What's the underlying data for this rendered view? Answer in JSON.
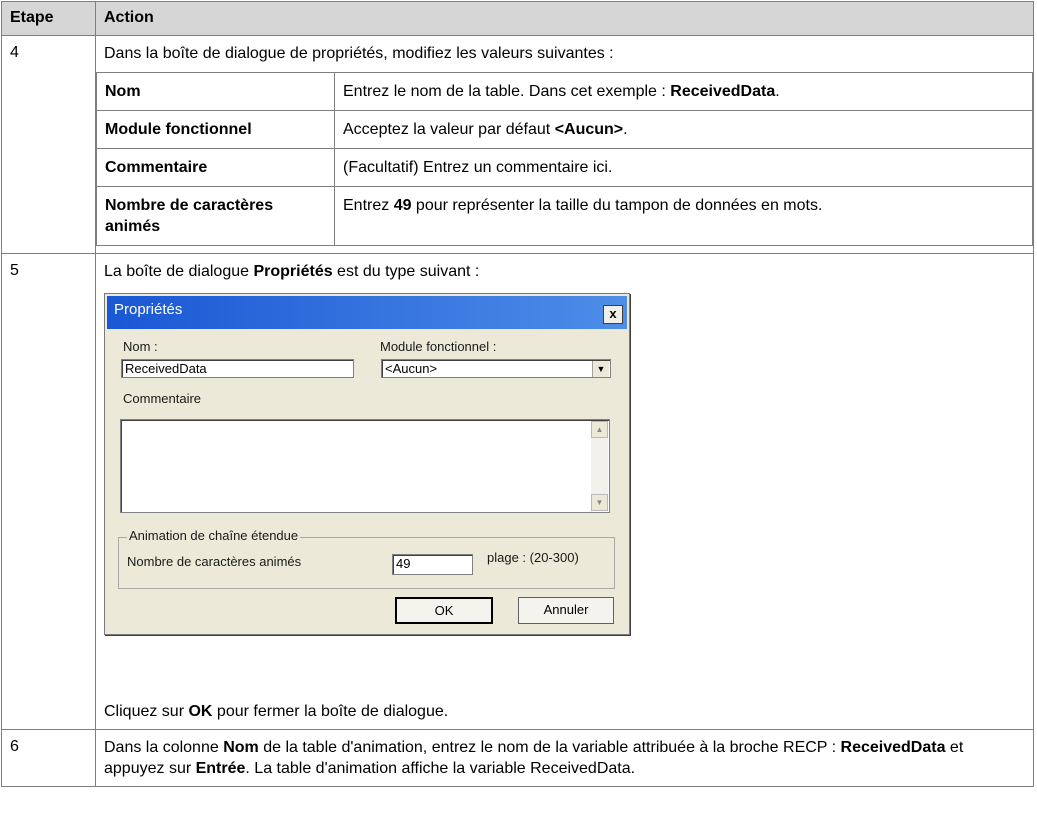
{
  "table": {
    "headers": {
      "step": "Etape",
      "action": "Action"
    }
  },
  "step4": {
    "number": "4",
    "intro": "Dans la boîte de dialogue de propriétés, modifiez les valeurs suivantes :",
    "rows": [
      {
        "key": "Nom",
        "pre": "Entrez le nom de la table. Dans cet exemple : ",
        "bold": "ReceivedData",
        "post": "."
      },
      {
        "key": "Module fonctionnel",
        "pre": "Acceptez la valeur par défaut ",
        "bold": "<Aucun>",
        "post": "."
      },
      {
        "key": "Commentaire",
        "pre": "(Facultatif) Entrez un commentaire ici.",
        "bold": "",
        "post": ""
      },
      {
        "key": "Nombre de caractères animés",
        "pre": "Entrez ",
        "bold": "49",
        "post": " pour représenter la taille du tampon de données en mots."
      }
    ]
  },
  "step5": {
    "number": "5",
    "intro_pre": "La boîte de dialogue ",
    "intro_bold": "Propriétés",
    "intro_post": " est du type suivant :",
    "outro_pre": "Cliquez sur ",
    "outro_bold": "OK",
    "outro_post": " pour fermer la boîte de dialogue."
  },
  "dialog": {
    "title": "Propriétés",
    "close": "x",
    "nom_label": "Nom :",
    "nom_value": "ReceivedData",
    "module_label": "Module fonctionnel :",
    "module_value": "<Aucun>",
    "comment_label": "Commentaire",
    "group_label": "Animation de chaîne étendue",
    "chars_label": "Nombre de caractères animés",
    "chars_value": "49",
    "range_label": "plage : (20-300)",
    "ok_label": "OK",
    "cancel_label": "Annuler"
  },
  "step6": {
    "number": "6",
    "p1": "Dans la colonne ",
    "b1": "Nom",
    "p2": " de la table d'animation, entrez le nom de la variable attribuée à la broche RECP : ",
    "b2": "ReceivedData",
    "p3": " et appuyez sur ",
    "b3": "Entrée",
    "p4": ". La table d'animation affiche la variable ReceivedData."
  }
}
